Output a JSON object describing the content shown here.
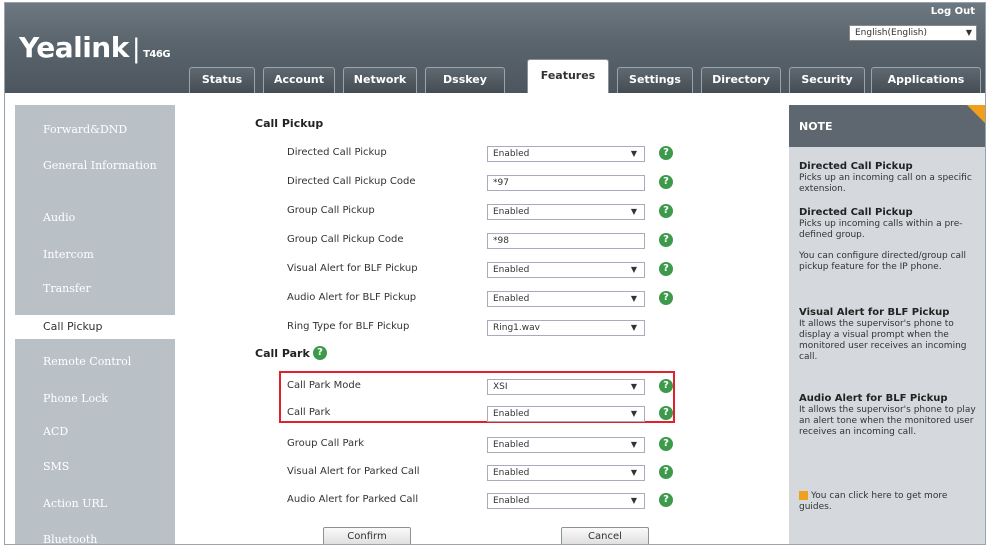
{
  "header": {
    "brand": "Yealink",
    "model": "T46G",
    "logout": "Log Out",
    "language": "English(English)"
  },
  "tabs": [
    "Status",
    "Account",
    "Network",
    "Dsskey",
    "Features",
    "Settings",
    "Directory",
    "Security",
    "Applications"
  ],
  "active_tab": "Features",
  "sidebar": {
    "items": [
      "Forward&DND",
      "General Information",
      "Audio",
      "Intercom",
      "Transfer",
      "Call Pickup",
      "Remote Control",
      "Phone Lock",
      "ACD",
      "SMS",
      "Action URL",
      "Bluetooth"
    ],
    "active": "Call Pickup"
  },
  "call_pickup": {
    "title": "Call Pickup",
    "rows": [
      {
        "label": "Directed Call Pickup",
        "value": "Enabled"
      },
      {
        "label": "Directed Call Pickup Code",
        "value": "*97"
      },
      {
        "label": "Group Call Pickup",
        "value": "Enabled"
      },
      {
        "label": "Group Call Pickup Code",
        "value": "*98"
      },
      {
        "label": "Visual Alert for BLF Pickup",
        "value": "Enabled"
      },
      {
        "label": "Audio Alert for BLF Pickup",
        "value": "Enabled"
      },
      {
        "label": "Ring Type for BLF Pickup",
        "value": "Ring1.wav"
      }
    ]
  },
  "call_park": {
    "title": "Call Park",
    "rows": [
      {
        "label": "Call Park Mode",
        "value": "XSI"
      },
      {
        "label": "Call Park",
        "value": "Enabled"
      },
      {
        "label": "Group Call Park",
        "value": "Enabled"
      },
      {
        "label": "Visual Alert for Parked Call",
        "value": "Enabled"
      },
      {
        "label": "Audio Alert for Parked Call",
        "value": "Enabled"
      }
    ]
  },
  "buttons": {
    "confirm": "Confirm",
    "cancel": "Cancel"
  },
  "note": {
    "title": "NOTE",
    "blocks": [
      {
        "title": "Directed Call Pickup",
        "text": "Picks up an incoming call on a specific extension."
      },
      {
        "title": "Directed Call Pickup",
        "text": "Picks up incoming calls within a pre-defined group."
      },
      {
        "title": "",
        "text": "You can configure directed/group call pickup feature for the IP phone."
      },
      {
        "title": "Visual Alert for BLF Pickup",
        "text": "It allows the supervisor's phone to display a visual prompt when the monitored user receives an incoming call."
      },
      {
        "title": "Audio Alert for BLF Pickup",
        "text": "It allows the supervisor's phone to play an alert tone when the monitored user receives an incoming call."
      }
    ],
    "guide": "You can click here to get more guides."
  },
  "colors": {
    "header": "#5a646c",
    "sidebar": "#b9c1c7",
    "help": "#3d9a4b",
    "highlight": "#e0202a",
    "accent": "#f1a01e"
  }
}
